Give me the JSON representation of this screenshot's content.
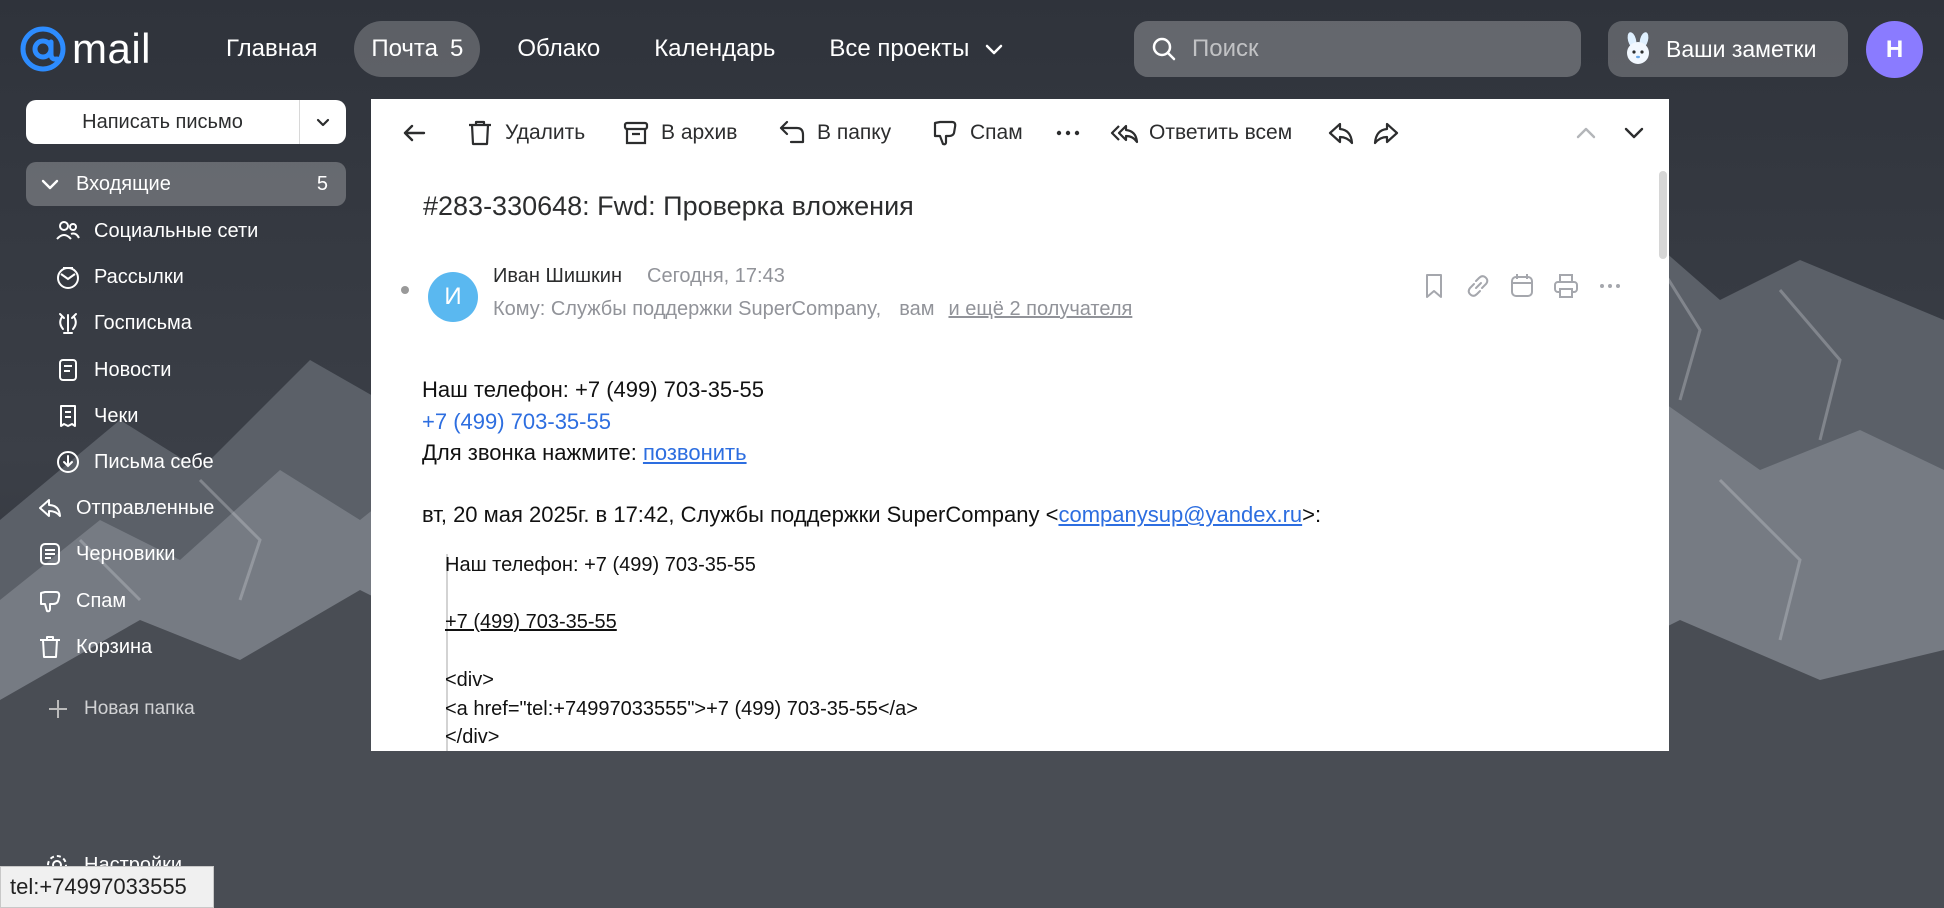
{
  "header": {
    "logo_text": "mail",
    "nav": [
      {
        "label": "Главная"
      },
      {
        "label": "Почта",
        "badge": "5"
      },
      {
        "label": "Облако"
      },
      {
        "label": "Календарь"
      },
      {
        "label": "Все проекты"
      }
    ],
    "search_placeholder": "Поиск",
    "notes_label": "Ваши заметки",
    "avatar_letter": "Н"
  },
  "sidebar": {
    "compose_label": "Написать письмо",
    "folders": [
      {
        "label": "Входящие",
        "count": "5",
        "icon": "chevron-down-icon"
      },
      {
        "label": "Социальные сети",
        "icon": "people-icon"
      },
      {
        "label": "Рассылки",
        "icon": "newsletter-icon"
      },
      {
        "label": "Госписьма",
        "icon": "emblem-icon"
      },
      {
        "label": "Новости",
        "icon": "news-icon"
      },
      {
        "label": "Чеки",
        "icon": "receipt-icon"
      },
      {
        "label": "Письма себе",
        "icon": "download-icon"
      },
      {
        "label": "Отправленные",
        "icon": "sent-icon"
      },
      {
        "label": "Черновики",
        "icon": "drafts-icon"
      },
      {
        "label": "Спам",
        "icon": "spam-icon"
      },
      {
        "label": "Корзина",
        "icon": "trash-icon"
      }
    ],
    "new_folder_label": "Новая папка",
    "settings_label": "Настройки"
  },
  "status_tooltip": "tel:+74997033555",
  "toolbar": {
    "delete_label": "Удалить",
    "archive_label": "В архив",
    "move_label": "В папку",
    "spam_label": "Спам",
    "reply_all_label": "Ответить всем"
  },
  "message": {
    "subject": "#283-330648: Fwd: Проверка вложения",
    "sender_initial": "И",
    "sender_name": "Иван Шишкин",
    "time": "Сегодня, 17:43",
    "to_prefix": "Кому: Службы поддержки SuperCompany,",
    "to_you": "вам",
    "more_recipients": "и ещё 2 получателя",
    "body": {
      "phone_line": "Наш телефон: +7 (499) 703-35-55",
      "phone_link": "+7 (499) 703-35-55",
      "call_prefix": "Для звонка нажмите: ",
      "call_link": "позвонить",
      "quote_header_prefix": "вт, 20 мая 2025г. в 17:42, Службы поддержки SuperCompany <",
      "quote_email": "companysup@yandex.ru",
      "quote_header_suffix": ">:"
    },
    "quote": {
      "line1": "Наш телефон: +7 (499) 703-35-55",
      "line2": "+7 (499) 703-35-55",
      "line3": "<div>",
      "line4": "<a href=\"tel:+74997033555\">+7 (499) 703-35-55</a>",
      "line5": "</div>"
    }
  }
}
